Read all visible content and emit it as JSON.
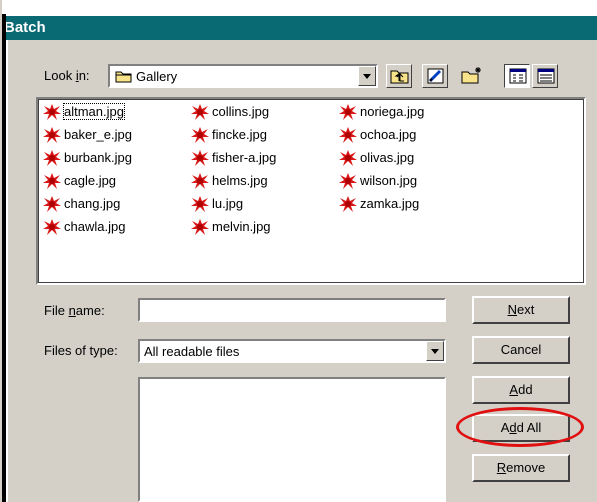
{
  "window": {
    "title": "Batch"
  },
  "look_in": {
    "label_pre": "Look ",
    "label_acc": "i",
    "label_post": "n:",
    "value": "Gallery"
  },
  "toolbar": {
    "icons": [
      "up-folder-icon",
      "edit-icon",
      "new-folder-icon",
      "list-view-icon",
      "details-view-icon"
    ]
  },
  "files": [
    {
      "name": "altman.jpg"
    },
    {
      "name": "baker_e.jpg"
    },
    {
      "name": "burbank.jpg"
    },
    {
      "name": "cagle.jpg"
    },
    {
      "name": "chang.jpg"
    },
    {
      "name": "chawla.jpg"
    },
    {
      "name": "collins.jpg"
    },
    {
      "name": "fincke.jpg"
    },
    {
      "name": "fisher-a.jpg"
    },
    {
      "name": "helms.jpg"
    },
    {
      "name": "lu.jpg"
    },
    {
      "name": "melvin.jpg"
    },
    {
      "name": "noriega.jpg"
    },
    {
      "name": "ochoa.jpg"
    },
    {
      "name": "olivas.jpg"
    },
    {
      "name": "wilson.jpg"
    },
    {
      "name": "zamka.jpg"
    }
  ],
  "file_name": {
    "label_pre": "File ",
    "label_acc": "n",
    "label_post": "ame:",
    "value": ""
  },
  "files_of_type": {
    "label": "Files of type:",
    "value": "All readable files"
  },
  "buttons": {
    "next": {
      "acc": "N",
      "rest": "ext"
    },
    "cancel": {
      "label": "Cancel"
    },
    "add": {
      "acc": "A",
      "rest": "dd"
    },
    "add_all": {
      "pre": "A",
      "acc": "d",
      "rest": "d All"
    },
    "remove": {
      "acc": "R",
      "rest": "emove"
    }
  },
  "colors": {
    "titlebar": "#0a6a74",
    "highlight": "#e01010",
    "face": "#d4d0c8"
  }
}
